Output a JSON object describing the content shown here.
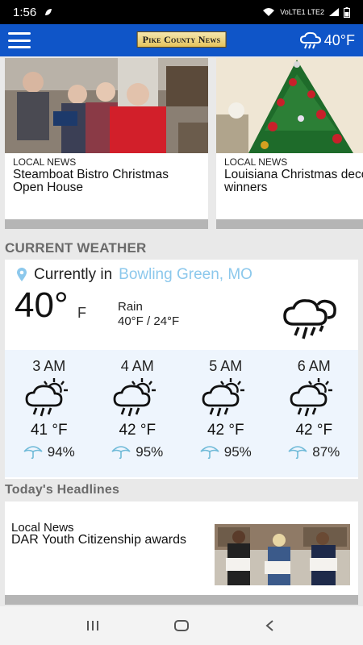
{
  "status_bar": {
    "time": "1:56",
    "network": "VoLTE1 LTE2"
  },
  "app_bar": {
    "logo_text": "Pike County News",
    "weather_temp": "40°F"
  },
  "cards": [
    {
      "category": "LOCAL NEWS",
      "headline": "Steamboat Bistro  Christmas Open House"
    },
    {
      "category": "LOCAL NEWS",
      "headline": "Louisiana Christmas decorating winners"
    }
  ],
  "current_weather": {
    "section_title": "CURRENT WEATHER",
    "location_prefix": "Currently in",
    "location": "Bowling Green, MO",
    "temp": "40°",
    "unit": "F",
    "condition": "Rain",
    "hi_lo": "40°F / 24°F",
    "hourly": [
      {
        "time": "3 AM",
        "temp": "41 °F",
        "precip": "94%"
      },
      {
        "time": "4 AM",
        "temp": "42 °F",
        "precip": "95%"
      },
      {
        "time": "5 AM",
        "temp": "42 °F",
        "precip": "95%"
      },
      {
        "time": "6 AM",
        "temp": "42 °F",
        "precip": "87%"
      }
    ]
  },
  "headlines": {
    "section_title": "Today's Headlines",
    "items": [
      {
        "category": "Local News",
        "headline": "DAR Youth Citizenship awards"
      }
    ]
  },
  "colors": {
    "app_bar": "#0f55c8",
    "location_link": "#8cc8ec",
    "hourly_bg": "#eef5fd",
    "section_title": "#6a6a6a"
  },
  "nav": {
    "recents": "recents-icon",
    "home": "home-icon",
    "back": "back-icon"
  }
}
